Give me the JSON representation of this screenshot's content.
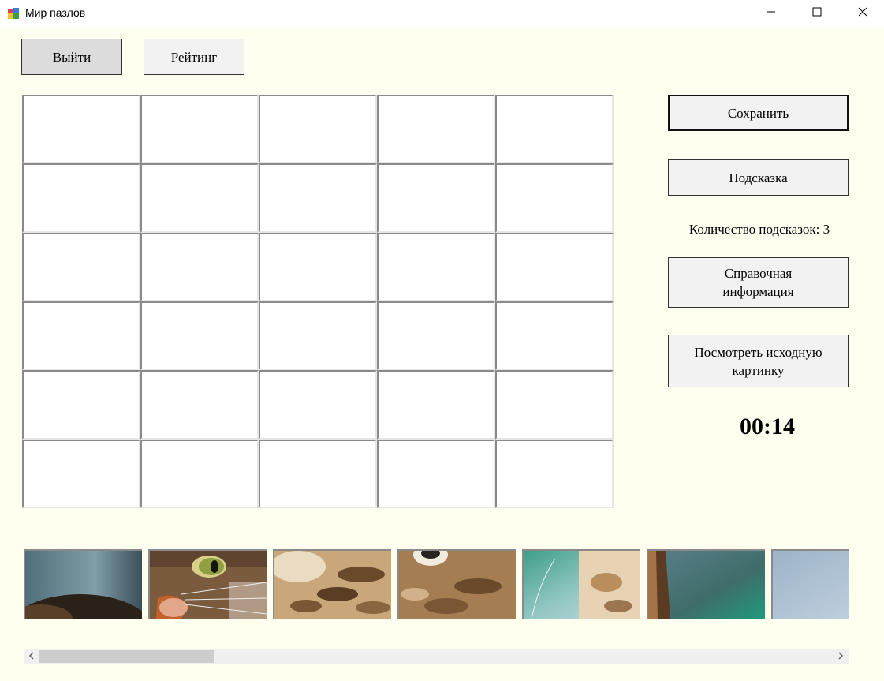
{
  "window": {
    "title": "Мир пазлов"
  },
  "toolbar": {
    "exit_label": "Выйти",
    "rating_label": "Рейтинг"
  },
  "side": {
    "save_label": "Сохранить",
    "hint_label": "Подсказка",
    "hint_count_text": "Количество подсказок: 3",
    "help_label_line1": "Справочная",
    "help_label_line2": "информация",
    "view_label_line1": "Посмотреть исходную",
    "view_label_line2": "картинку",
    "timer": "00:14"
  },
  "board": {
    "columns": 5,
    "rows": 6
  },
  "pieces": [
    {
      "name": "piece-1",
      "desc": "blurred background with dark fur corner"
    },
    {
      "name": "piece-2",
      "desc": "cat face with green eye and whiskers"
    },
    {
      "name": "piece-3",
      "desc": "spotted fur"
    },
    {
      "name": "piece-4",
      "desc": "cat chin with fur"
    },
    {
      "name": "piece-5",
      "desc": "teal background with light fur"
    },
    {
      "name": "piece-6",
      "desc": "dark fur edge with green background"
    },
    {
      "name": "piece-7",
      "desc": "light blue background"
    }
  ]
}
